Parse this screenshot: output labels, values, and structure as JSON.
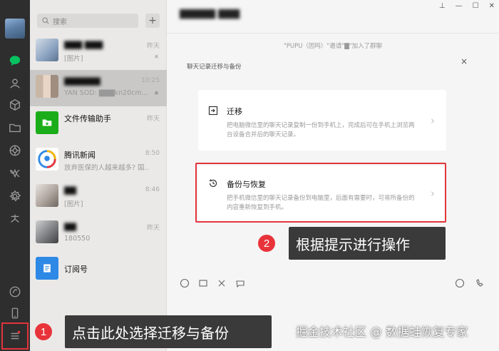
{
  "search": {
    "placeholder": "搜索",
    "add_label": "+"
  },
  "chats": [
    {
      "name": "▇▇▇ ▇▇▇",
      "snippet": "[图片]",
      "time": "昨天"
    },
    {
      "name": "▇▇▇▇▇▇",
      "snippet": "YAN SOD: ▇▇▇kn20cm...",
      "time": "10:25"
    },
    {
      "name": "文件传输助手",
      "snippet": "",
      "time": "昨天"
    },
    {
      "name": "腾讯新闻",
      "snippet": "放弃医保的人越来越多? 国...",
      "time": "8:50"
    },
    {
      "name": "▇▇",
      "snippet": "[图片]",
      "time": "8:46"
    },
    {
      "name": "▇▇",
      "snippet": "180550",
      "time": "昨天"
    },
    {
      "name": "订阅号",
      "snippet": "",
      "time": ""
    }
  ],
  "header": {
    "title": "▇▇▇▇▇ ▇▇▇",
    "pin": "⊥",
    "min": "—",
    "max": "☐",
    "close": "✕"
  },
  "system_message": "\"PUPU（因吗）\"邀请\"▇\"加入了群聊",
  "panel": {
    "title": "聊天记录迁移与备份",
    "close": "×",
    "migrate": {
      "title": "迁移",
      "desc": "把电脑微信里的聊天记录复制一份到手机上，完成后可在手机上浏览两台设备合并后的聊天记录。"
    },
    "backup": {
      "title": "备份与恢复",
      "desc": "把手机微信里的聊天记录备份到电脑里，后面有需要时，可将所备份的内容重新恢复到手机。"
    },
    "arrow": "›"
  },
  "hints": {
    "step1_num": "1",
    "step1_text": "点击此处选择迁移与备份",
    "step2_num": "2",
    "step2_text": "根据提示进行操作"
  },
  "watermark": "掘金技术社区 @ 数据蛙恢复专家",
  "colors": {
    "accent_red": "#e3343b",
    "wechat_green": "#07c160",
    "rail_bg": "#2e2e2e"
  }
}
